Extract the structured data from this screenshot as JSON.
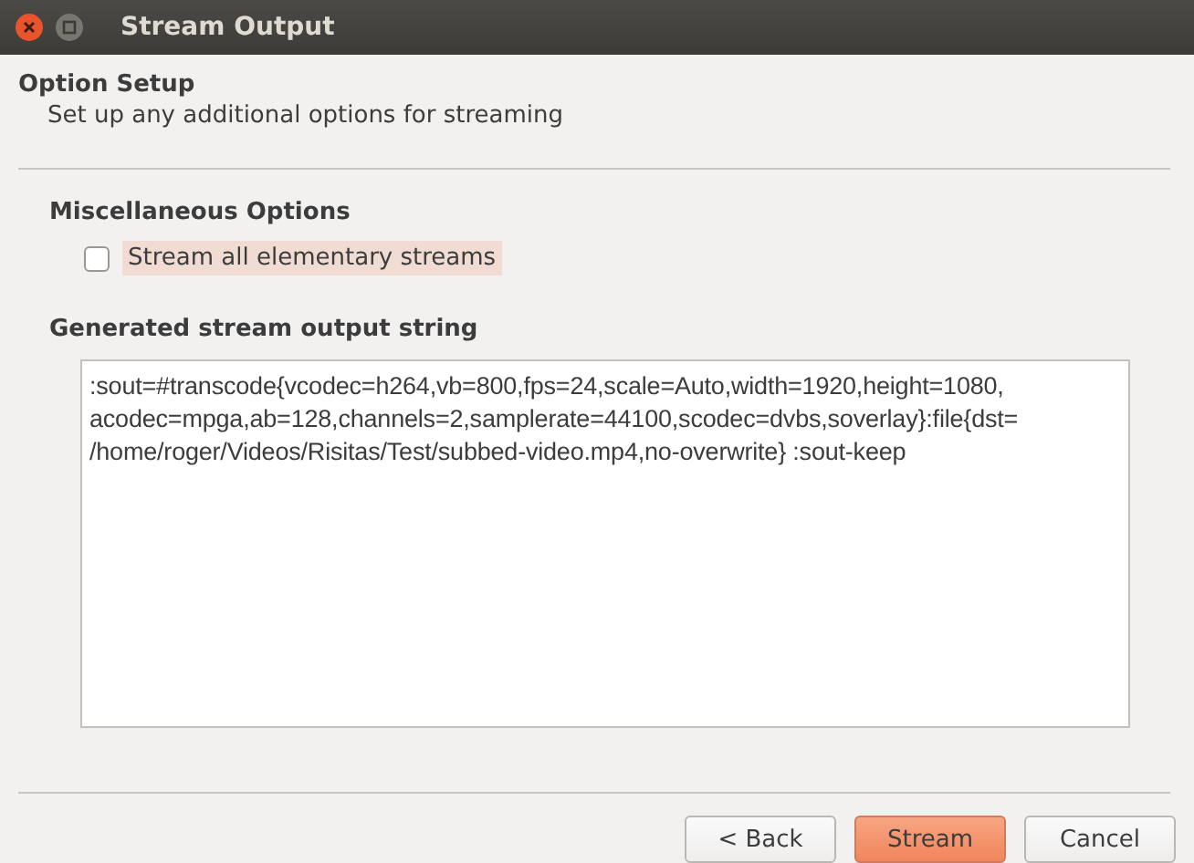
{
  "window": {
    "title": "Stream Output"
  },
  "header": {
    "title": "Option Setup",
    "subtitle": "Set up any additional options for streaming"
  },
  "misc": {
    "title": "Miscellaneous Options",
    "option": {
      "label": "Stream all elementary streams",
      "checked": false,
      "focused": true
    }
  },
  "output": {
    "title": "Generated stream output string",
    "lines": [
      ":sout=#transcode{vcodec=h264,vb=800,fps=24,scale=Auto,width=1920,height=1080,",
      "acodec=mpga,ab=128,channels=2,samplerate=44100,scodec=dvbs,soverlay}:file{dst=",
      "/home/roger/Videos/Risitas/Test/subbed-video.mp4,no-overwrite} :sout-keep"
    ]
  },
  "buttons": [
    {
      "label": "< Back",
      "kind": "normal"
    },
    {
      "label": "Stream",
      "kind": "default"
    },
    {
      "label": "Cancel",
      "kind": "normal"
    }
  ]
}
